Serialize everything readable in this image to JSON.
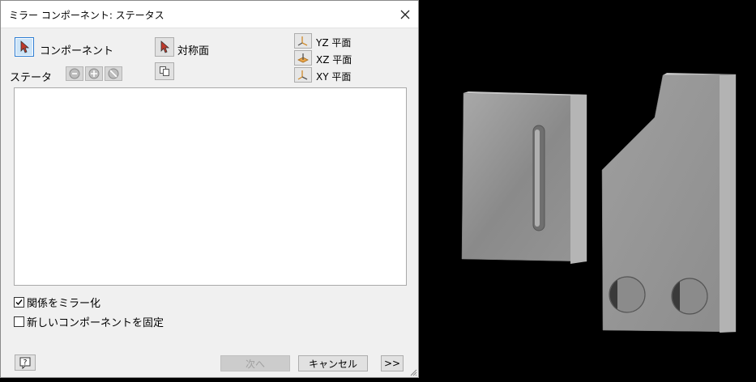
{
  "dialog": {
    "title": "ミラー コンポーネント: ステータス",
    "component_label": "コンポーネント",
    "mirror_plane_label": "対称面",
    "status_label": "ステータ",
    "planes": [
      "YZ 平面",
      "XZ 平面",
      "XY 平面"
    ],
    "checkboxes": [
      {
        "label": "関係をミラー化",
        "checked": true
      },
      {
        "label": "新しいコンポーネントを固定",
        "checked": false
      }
    ],
    "buttons": {
      "next": "次へ",
      "cancel": "キャンセル",
      "expand": ">>",
      "help": "?"
    }
  },
  "colors": {
    "dialog_bg": "#f0f0f0",
    "active_button": "#cce4f7",
    "viewport_bg": "#000000",
    "part_gray": "#8c8c8c"
  },
  "icons": [
    "cursor-arrow-icon",
    "mirror-plane-icon",
    "copy-icon",
    "include-icon",
    "mirror-icon",
    "exclude-icon",
    "plane-axis-icon",
    "help-icon",
    "close-icon"
  ]
}
